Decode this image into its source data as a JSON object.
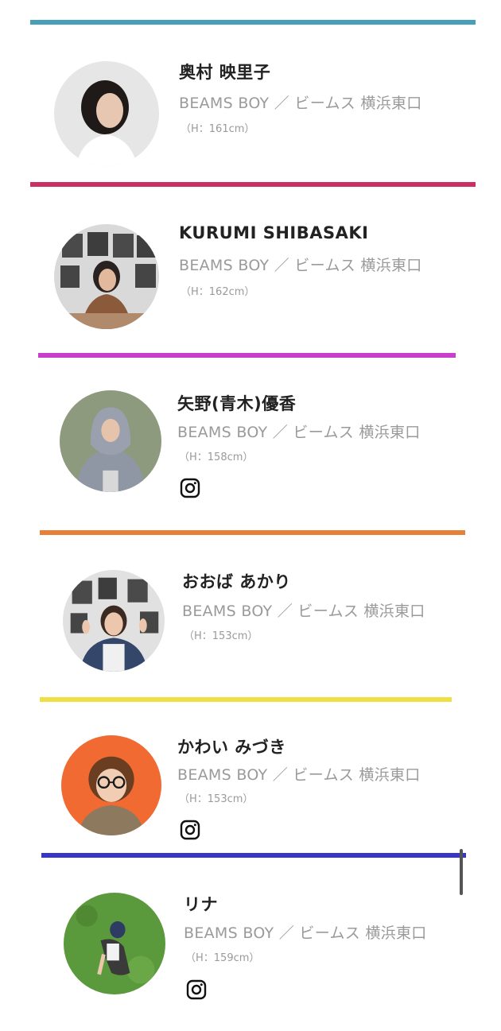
{
  "staff": [
    {
      "name": "奥村 映里子",
      "shop": "BEAMS BOY ／ ビームス 横浜東口",
      "height": "（H：161cm）",
      "accent": "#47a0b8",
      "instagram": false,
      "avatar_bg": "#e6e6e6"
    },
    {
      "name": "KURUMI SHIBASAKI",
      "shop": "BEAMS BOY ／ ビームス 横浜東口",
      "height": "（H：162cm）",
      "accent": "#cc2f63",
      "instagram": false,
      "avatar_bg": "#d9d9d9"
    },
    {
      "name": "矢野(青木)優香",
      "shop": "BEAMS BOY ／ ビームス 横浜東口",
      "height": "（H：158cm）",
      "accent": "#c93ecb",
      "instagram": true,
      "avatar_bg": "#8d9a7e"
    },
    {
      "name": "おおば あかり",
      "shop": "BEAMS BOY ／ ビームス 横浜東口",
      "height": "（H：153cm）",
      "accent": "#e67f38",
      "instagram": false,
      "avatar_bg": "#e1e1e1"
    },
    {
      "name": "かわい みづき",
      "shop": "BEAMS BOY ／ ビームス 横浜東口",
      "height": "（H：153cm）",
      "accent": "#f0df45",
      "instagram": true,
      "avatar_bg": "#f06a32"
    },
    {
      "name": "リナ",
      "shop": "BEAMS BOY ／ ビームス 横浜東口",
      "height": "（H：159cm）",
      "accent": "#3a35c9",
      "instagram": true,
      "avatar_bg": "#5b9a3c"
    }
  ]
}
